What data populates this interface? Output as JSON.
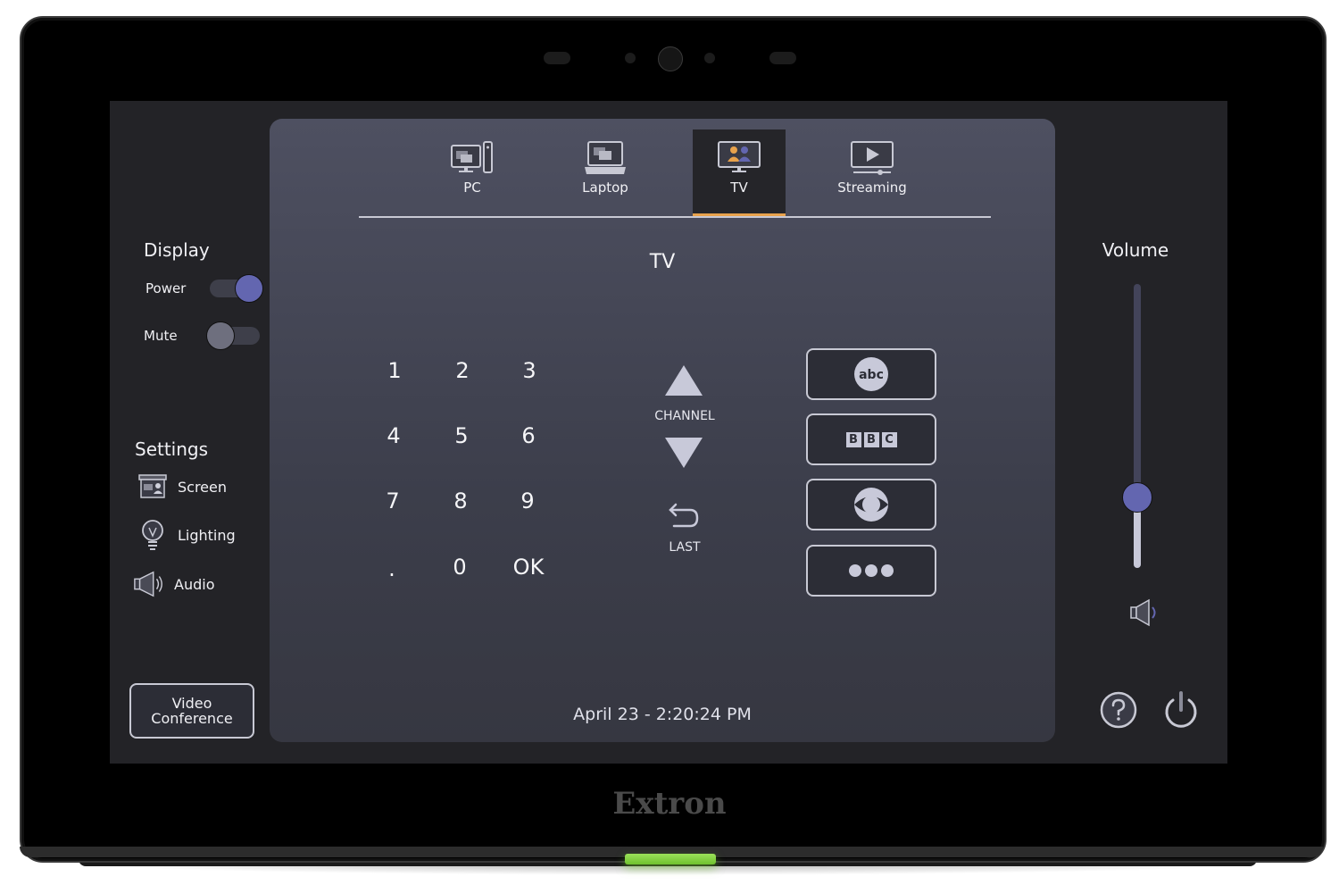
{
  "device": {
    "brand": "Extron",
    "led_color": "#7ed03c"
  },
  "left": {
    "display": {
      "title": "Display",
      "power_label": "Power",
      "power_on": true,
      "mute_label": "Mute",
      "mute_on": false
    },
    "settings": {
      "title": "Settings",
      "items": [
        {
          "label": "Screen",
          "icon": "projector-screen-icon"
        },
        {
          "label": "Lighting",
          "icon": "lightbulb-icon"
        },
        {
          "label": "Audio",
          "icon": "speaker-icon"
        }
      ]
    },
    "video_conference": {
      "line1": "Video",
      "line2": "Conference"
    }
  },
  "main": {
    "tabs": [
      {
        "label": "PC",
        "icon": "pc-icon",
        "active": false
      },
      {
        "label": "Laptop",
        "icon": "laptop-icon",
        "active": false
      },
      {
        "label": "TV",
        "icon": "tv-icon",
        "active": true
      },
      {
        "label": "Streaming",
        "icon": "streaming-icon",
        "active": false
      }
    ],
    "view_title": "TV",
    "keypad": [
      "1",
      "2",
      "3",
      "4",
      "5",
      "6",
      "7",
      "8",
      "9",
      ".",
      "0",
      "OK"
    ],
    "channel_label": "CHANNEL",
    "last_label": "LAST",
    "presets": [
      {
        "name": "abc",
        "icon": "abc-logo-icon"
      },
      {
        "name": "BBC",
        "letters": [
          "B",
          "B",
          "C"
        ],
        "icon": "bbc-logo-icon"
      },
      {
        "name": "CBS",
        "icon": "cbs-eye-icon"
      },
      {
        "name": "More",
        "icon": "more-dots-icon"
      }
    ],
    "datetime": "April 23 - 2:20:24 PM"
  },
  "right": {
    "volume_title": "Volume",
    "volume_level": 0.25,
    "help_icon": "help-icon",
    "power_icon": "power-icon"
  },
  "colors": {
    "accent": "#6366b0",
    "active_tab_underline": "#e8a24c",
    "panel": "#464857",
    "screen_bg": "#232327"
  }
}
